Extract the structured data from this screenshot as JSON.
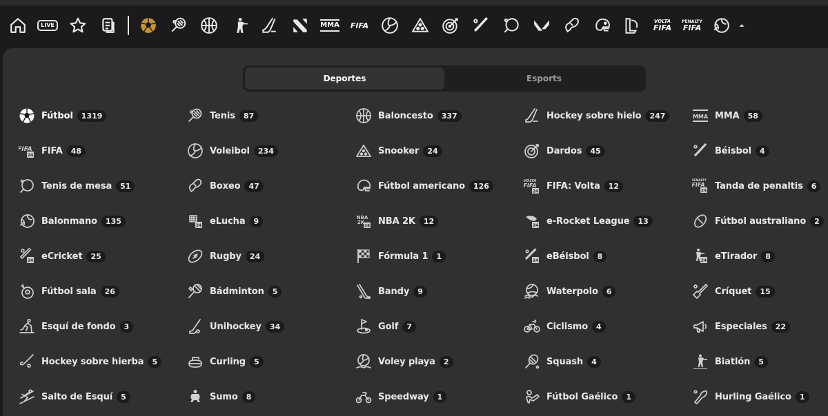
{
  "colors": {
    "accent": "#c9962d",
    "background": "#303030",
    "navbar": "#1b1b1b",
    "text": "#e9e9e9",
    "badge": "#1b1b1b"
  },
  "nav": {
    "icons": [
      {
        "name": "home-icon"
      },
      {
        "name": "live-icon",
        "label": "LIVE"
      },
      {
        "name": "star-icon"
      },
      {
        "name": "document-icon"
      },
      {
        "name": "soccer-ball-icon",
        "active": true
      },
      {
        "name": "tennis-icon"
      },
      {
        "name": "basketball-icon"
      },
      {
        "name": "shooter-icon"
      },
      {
        "name": "hockey-icon"
      },
      {
        "name": "brand-logo-icon"
      },
      {
        "name": "mma-icon",
        "label": "MMA"
      },
      {
        "name": "fifa-icon",
        "label": "FIFA"
      },
      {
        "name": "volleyball-icon"
      },
      {
        "name": "snooker-icon"
      },
      {
        "name": "darts-icon"
      },
      {
        "name": "baseball-icon"
      },
      {
        "name": "table-tennis-icon"
      },
      {
        "name": "valorant-icon"
      },
      {
        "name": "boxing-icon"
      },
      {
        "name": "football-helmet-icon"
      },
      {
        "name": "league-of-legends-icon"
      },
      {
        "name": "fifa-volta-icon",
        "label_top": "VOLTA",
        "label": "FIFA"
      },
      {
        "name": "penalty-fifa-icon",
        "label_top": "PENALTY",
        "label": "FIFA"
      },
      {
        "name": "handball-icon"
      },
      {
        "name": "collapse-caret-icon"
      }
    ]
  },
  "tabs": [
    {
      "label": "Deportes",
      "active": true
    },
    {
      "label": "Esports",
      "active": false
    }
  ],
  "sports": [
    {
      "name": "Fútbol",
      "count": "1319",
      "icon": "soccer-ball-icon"
    },
    {
      "name": "Tenis",
      "count": "87",
      "icon": "tennis-icon"
    },
    {
      "name": "Baloncesto",
      "count": "337",
      "icon": "basketball-icon"
    },
    {
      "name": "Hockey sobre hielo",
      "count": "247",
      "icon": "hockey-icon"
    },
    {
      "name": "MMA",
      "count": "58",
      "icon": "mma-icon"
    },
    {
      "name": "FIFA",
      "count": "48",
      "icon": "fifa-icon"
    },
    {
      "name": "Voleibol",
      "count": "234",
      "icon": "volleyball-icon"
    },
    {
      "name": "Snooker",
      "count": "24",
      "icon": "snooker-icon"
    },
    {
      "name": "Dardos",
      "count": "45",
      "icon": "darts-icon"
    },
    {
      "name": "Béisbol",
      "count": "4",
      "icon": "baseball-icon"
    },
    {
      "name": "Tenis de mesa",
      "count": "51",
      "icon": "table-tennis-icon"
    },
    {
      "name": "Boxeo",
      "count": "47",
      "icon": "boxing-icon"
    },
    {
      "name": "Fútbol americano",
      "count": "126",
      "icon": "football-helmet-icon"
    },
    {
      "name": "FIFA: Volta",
      "count": "12",
      "icon": "fifa-volta-icon"
    },
    {
      "name": "Tanda de penaltis",
      "count": "6",
      "icon": "penalty-fifa-icon"
    },
    {
      "name": "Balonmano",
      "count": "135",
      "icon": "handball-icon"
    },
    {
      "name": "eLucha",
      "count": "9",
      "icon": "fist-icon"
    },
    {
      "name": "NBA 2K",
      "count": "12",
      "icon": "nba2k-icon"
    },
    {
      "name": "e-Rocket League",
      "count": "13",
      "icon": "rocket-league-icon"
    },
    {
      "name": "Fútbol australiano",
      "count": "2",
      "icon": "aussie-football-icon"
    },
    {
      "name": "eCricket",
      "count": "25",
      "icon": "ecricket-icon"
    },
    {
      "name": "Rugby",
      "count": "24",
      "icon": "rugby-ball-icon"
    },
    {
      "name": "Fórmula 1",
      "count": "1",
      "icon": "checkered-flag-icon"
    },
    {
      "name": "eBéisbol",
      "count": "8",
      "icon": "ebaseball-icon"
    },
    {
      "name": "eTirador",
      "count": "8",
      "icon": "eshooter-icon"
    },
    {
      "name": "Fútbol sala",
      "count": "26",
      "icon": "futsal-icon"
    },
    {
      "name": "Bádminton",
      "count": "5",
      "icon": "badminton-icon"
    },
    {
      "name": "Bandy",
      "count": "9",
      "icon": "bandy-stick-icon"
    },
    {
      "name": "Waterpolo",
      "count": "6",
      "icon": "waterpolo-icon"
    },
    {
      "name": "Críquet",
      "count": "15",
      "icon": "cricket-bat-icon"
    },
    {
      "name": "Esquí de fondo",
      "count": "3",
      "icon": "cross-country-ski-icon"
    },
    {
      "name": "Unihockey",
      "count": "34",
      "icon": "floorball-icon"
    },
    {
      "name": "Golf",
      "count": "7",
      "icon": "golf-icon"
    },
    {
      "name": "Ciclismo",
      "count": "4",
      "icon": "bicycle-icon"
    },
    {
      "name": "Especiales",
      "count": "22",
      "icon": "megaphone-icon"
    },
    {
      "name": "Hockey sobre hierba",
      "count": "5",
      "icon": "field-hockey-icon"
    },
    {
      "name": "Curling",
      "count": "5",
      "icon": "curling-stone-icon"
    },
    {
      "name": "Voley playa",
      "count": "2",
      "icon": "beach-volleyball-icon"
    },
    {
      "name": "Squash",
      "count": "4",
      "icon": "squash-racket-icon"
    },
    {
      "name": "Biatlón",
      "count": "5",
      "icon": "biathlon-icon"
    },
    {
      "name": "Salto de Esquí",
      "count": "5",
      "icon": "ski-jump-icon"
    },
    {
      "name": "Sumo",
      "count": "8",
      "icon": "sumo-icon"
    },
    {
      "name": "Speedway",
      "count": "1",
      "icon": "motorbike-icon"
    },
    {
      "name": "Fútbol Gaélico",
      "count": "1",
      "icon": "gaelic-football-icon"
    },
    {
      "name": "Hurling Gaélico",
      "count": "1",
      "icon": "hurling-icon"
    }
  ]
}
